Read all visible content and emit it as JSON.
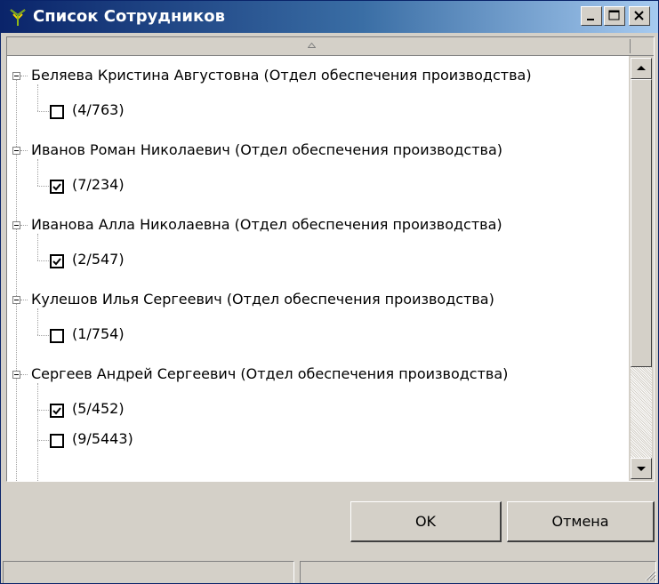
{
  "window": {
    "title": "Список Сотрудников",
    "controls": {
      "minimize": "minimize",
      "maximize": "maximize",
      "close": "close"
    }
  },
  "employees": [
    {
      "label": "Беляева Кристина Августовна (Отдел обеспечения производства)",
      "cards": [
        {
          "label": "(4/763)",
          "checked": false
        }
      ]
    },
    {
      "label": "Иванов Роман Николаевич (Отдел обеспечения производства)",
      "cards": [
        {
          "label": "(7/234)",
          "checked": true
        }
      ]
    },
    {
      "label": "Иванова Алла Николаевна (Отдел обеспечения производства)",
      "cards": [
        {
          "label": "(2/547)",
          "checked": true
        }
      ]
    },
    {
      "label": "Кулешов Илья Сергеевич (Отдел обеспечения производства)",
      "cards": [
        {
          "label": "(1/754)",
          "checked": false
        }
      ]
    },
    {
      "label": "Сергеев Андрей Сергеевич (Отдел обеспечения производства)",
      "cards": [
        {
          "label": "(5/452)",
          "checked": true
        },
        {
          "label": "(9/5443)",
          "checked": false
        }
      ]
    }
  ],
  "buttons": {
    "ok": "OK",
    "cancel": "Отмена"
  },
  "icons": {
    "app": "users-tree-icon",
    "expander": "tree-collapse-icon",
    "sort": "sort-up-icon",
    "scroll_up": "scroll-up-icon",
    "scroll_down": "scroll-down-icon",
    "grip": "resize-grip-icon"
  },
  "colors": {
    "title_start": "#0a246a",
    "title_end": "#a6caf0",
    "face": "#d4d0c8"
  }
}
